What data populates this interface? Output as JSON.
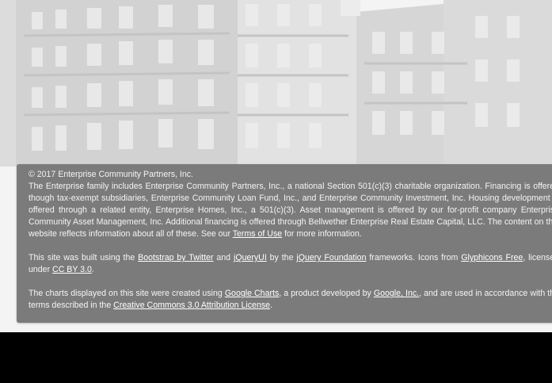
{
  "footer": {
    "copyright": "© 2017 Enterprise Community Partners, Inc.",
    "para1": {
      "t1": "The Enterprise family includes Enterprise Community Partners, Inc., a national Section 501(c)(3) charitable organization. Financing is offered though tax-exempt subsidiaries, Enterprise Community Loan Fund, Inc., and Enterprise Community Investment, Inc. Housing development is offered through a related entity, Enterprise Homes, Inc., a 501(c)(3). Asset management is offered by our for-profit company Enterprise Community Asset Management, Inc. Additional financing is offered through Bellwether Enterprise Real Estate Capital, LLC. The content on this website reflects information about all of these. See our ",
      "terms_link": "Terms of Use",
      "t2": " for more information."
    },
    "para2": {
      "t1": "This site was built using the ",
      "bootstrap_link": "Bootstrap by Twitter",
      "t2": " and ",
      "jqueryui_link": "jQueryUI",
      "t3": " by the ",
      "jquery_foundation_link": "jQuery Foundation",
      "t4": " frameworks. Icons from ",
      "glyphicons_link": "Glyphicons Free",
      "t5": ", licensed under ",
      "ccby_link": "CC BY 3.0",
      "t6": "."
    },
    "para3": {
      "t1": "The charts displayed on this site were created using ",
      "google_charts_link": "Google Charts",
      "t2": ", a product developed by ",
      "google_link": "Google, Inc.",
      "t3": ", and are used in accordance with the terms described in the ",
      "cc_attribution_link": "Creative Commons 3.0 Attribution License",
      "t4": "."
    }
  },
  "colors": {
    "panel_background": "#7b7b7b",
    "panel_text": "#f4f4f4",
    "page_background": "#000000"
  }
}
